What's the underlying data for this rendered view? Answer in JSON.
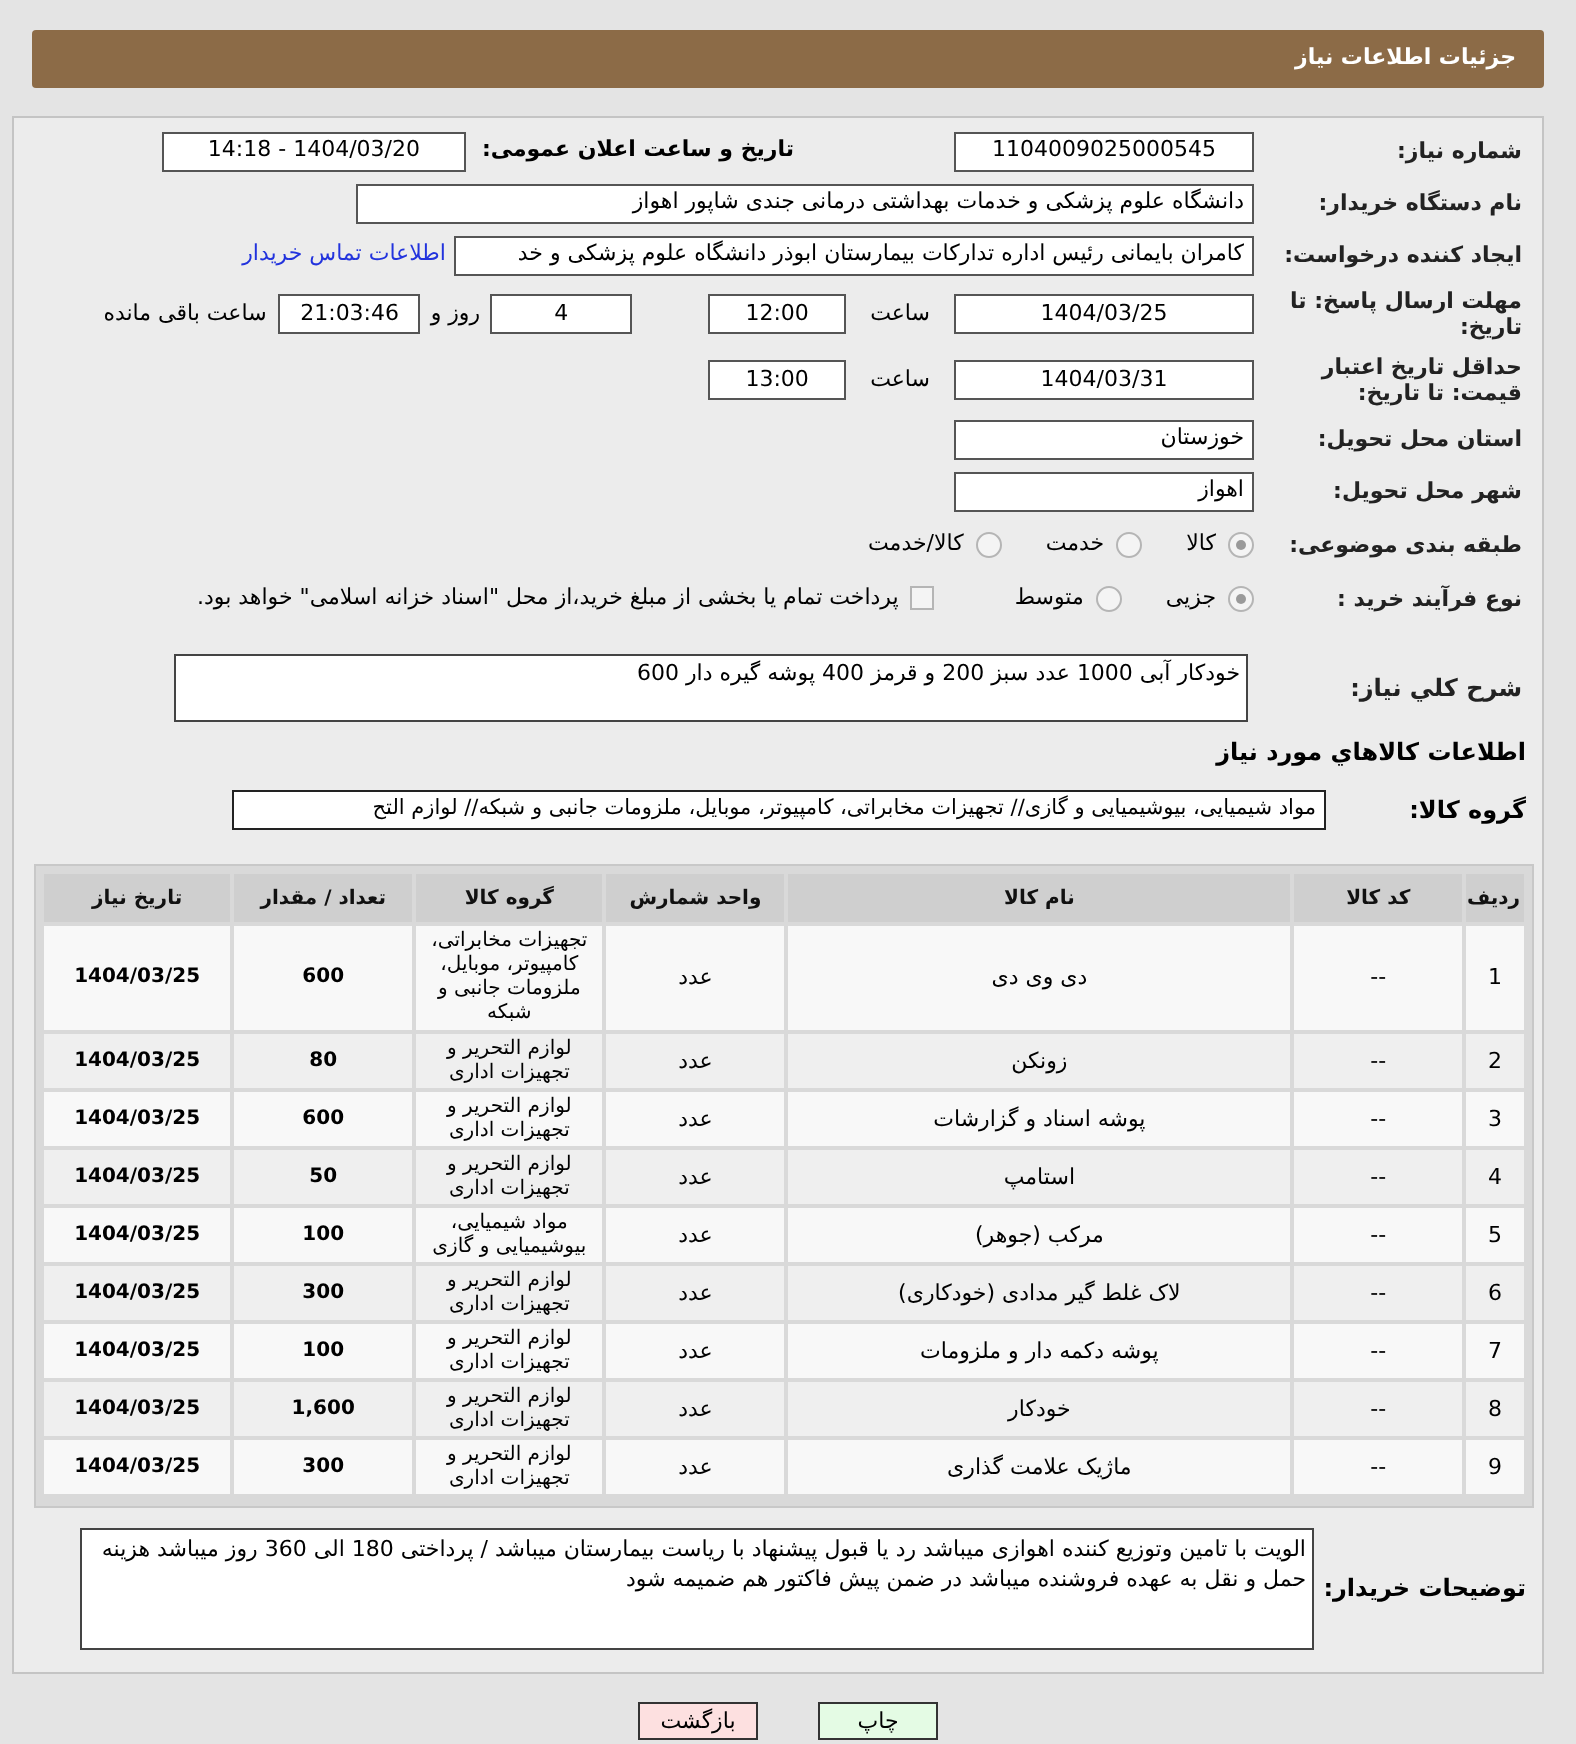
{
  "header": {
    "title": "جزئیات اطلاعات نیاز"
  },
  "fields": {
    "need_number": {
      "label": "شماره نیاز:",
      "value": "1104009025000545"
    },
    "announce": {
      "label": "تاریخ و ساعت اعلان عمومی:",
      "value": "1404/03/20 - 14:18"
    },
    "buyer_org": {
      "label": "نام دستگاه خریدار:",
      "value": "دانشگاه علوم پزشکی و خدمات بهداشتی درمانی جندی شاپور اهواز"
    },
    "requester": {
      "label": "ایجاد کننده درخواست:",
      "value": "کامران بایمانی رئیس اداره تدارکات بیمارستان ابوذر  دانشگاه علوم پزشکی و خد",
      "link": "اطلاعات تماس خریدار"
    },
    "deadline": {
      "label": "مهلت ارسال پاسخ: تا تاریخ:",
      "date": "1404/03/25",
      "time_label": "ساعت",
      "time": "12:00",
      "days": "4",
      "days_label": "روز و",
      "remaining": "21:03:46",
      "remaining_label": "ساعت باقی مانده"
    },
    "validity": {
      "label": "حداقل تاریخ اعتبار قیمت: تا تاریخ:",
      "date": "1404/03/31",
      "time_label": "ساعت",
      "time": "13:00"
    },
    "province": {
      "label": "استان محل تحویل:",
      "value": "خوزستان"
    },
    "city": {
      "label": "شهر محل تحویل:",
      "value": "اهواز"
    },
    "category": {
      "label": "طبقه بندی موضوعی:",
      "options": [
        {
          "label": "کالا",
          "selected": true
        },
        {
          "label": "خدمت",
          "selected": false
        },
        {
          "label": "کالا/خدمت",
          "selected": false
        }
      ]
    },
    "process": {
      "label": "نوع فرآیند خرید :",
      "options": [
        {
          "label": "جزیی",
          "selected": true
        },
        {
          "label": "متوسط",
          "selected": false
        }
      ],
      "checkbox": {
        "label": "پرداخت تمام یا بخشی از مبلغ خرید،از محل \"اسناد خزانه اسلامی\" خواهد بود.",
        "checked": false
      }
    },
    "description": {
      "label": "شرح کلي نياز:",
      "value": "خودکار آبی 1000 عدد سبز 200 و قرمز 400 پوشه گیره دار 600"
    }
  },
  "goods": {
    "title": "اطلاعات کالاهاي مورد نياز",
    "group_label": "گروه کالا:",
    "group_value": "مواد شیمیایی، بیوشیمیایی و  گازی// تجهیزات مخابراتی، کامپیوتر، موبایل، ملزومات جانبی و شبکه// لوازم التح",
    "table": {
      "columns": [
        "ردیف",
        "کد کالا",
        "نام کالا",
        "واحد شمارش",
        "گروه کالا",
        "تعداد / مقدار",
        "تاریخ نیاز"
      ],
      "rows": [
        [
          "1",
          "--",
          "دی وی دی",
          "عدد",
          "تجهیزات مخابراتی، کامپیوتر، موبایل، ملزومات جانبی و شبکه",
          "600",
          "1404/03/25"
        ],
        [
          "2",
          "--",
          "زونکن",
          "عدد",
          "لوازم التحریر و تجهیزات اداری",
          "80",
          "1404/03/25"
        ],
        [
          "3",
          "--",
          "پوشه اسناد و گزارشات",
          "عدد",
          "لوازم التحریر و تجهیزات اداری",
          "600",
          "1404/03/25"
        ],
        [
          "4",
          "--",
          "استامپ",
          "عدد",
          "لوازم التحریر و تجهیزات اداری",
          "50",
          "1404/03/25"
        ],
        [
          "5",
          "--",
          "مرکب (جوهر)",
          "عدد",
          "مواد شیمیایی، بیوشیمیایی و گازی",
          "100",
          "1404/03/25"
        ],
        [
          "6",
          "--",
          "لاک غلط گیر مدادی (خودکاری)",
          "عدد",
          "لوازم التحریر و تجهیزات اداری",
          "300",
          "1404/03/25"
        ],
        [
          "7",
          "--",
          "پوشه دکمه دار و ملزومات",
          "عدد",
          "لوازم التحریر و تجهیزات اداری",
          "100",
          "1404/03/25"
        ],
        [
          "8",
          "--",
          "خودکار",
          "عدد",
          "لوازم التحریر و تجهیزات اداری",
          "1,600",
          "1404/03/25"
        ],
        [
          "9",
          "--",
          "ماژیک علامت گذاری",
          "عدد",
          "لوازم التحریر و تجهیزات اداری",
          "300",
          "1404/03/25"
        ]
      ]
    }
  },
  "notes": {
    "label": "توضیحات خریدار:",
    "value": "الویت با تامین وتوزیع کننده اهوازی  میباشد رد یا قبول پیشنهاد با ریاست بیمارستان میباشد / پرداختی 180 الی 360 روز میباشد  هزینه حمل و نقل به عهده فروشنده میباشد  در ضمن پیش فاکتور هم ضمیمه شود"
  },
  "buttons": [
    {
      "kind": "print",
      "label": "چاپ"
    },
    {
      "kind": "back",
      "label": "بازگشت"
    }
  ]
}
